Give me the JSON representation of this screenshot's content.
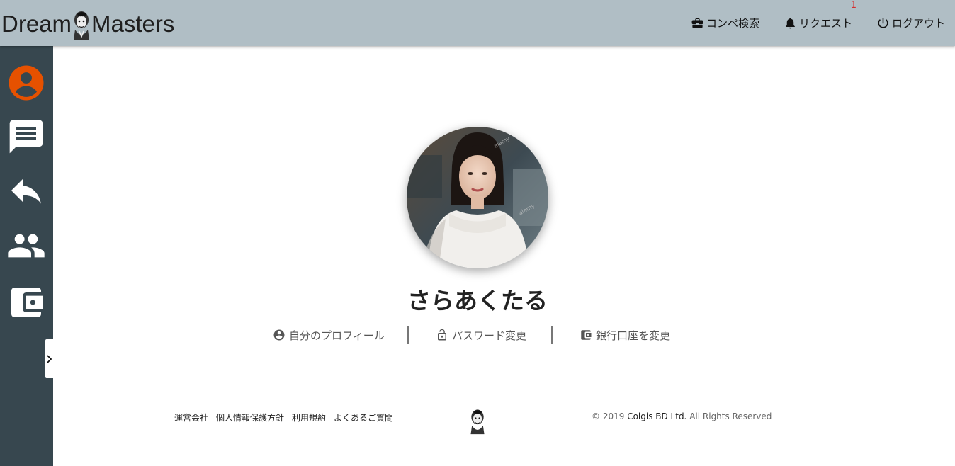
{
  "header": {
    "logo_left": "Dream",
    "logo_right": "Masters",
    "nav": {
      "search_label": "コンペ検索",
      "request_label": "リクエスト",
      "request_badge": "1",
      "logout_label": "ログアウト"
    }
  },
  "sidebar": {
    "items": [
      {
        "icon": "account-circle-icon",
        "active": true
      },
      {
        "icon": "message-icon",
        "active": false
      },
      {
        "icon": "reply-icon",
        "active": false
      },
      {
        "icon": "people-icon",
        "active": false
      },
      {
        "icon": "wallet-icon",
        "active": false
      }
    ],
    "active_color": "#e65100",
    "icon_color": "#ffffff"
  },
  "profile": {
    "name": "さらあくたる",
    "links": {
      "profile_label": "自分のプロフィール",
      "password_label": "パスワード変更",
      "bank_label": "銀行口座を変更"
    }
  },
  "footer": {
    "links": [
      "運営会社",
      "個人情報保護方針",
      "利用規約",
      "よくあるご質問"
    ],
    "copyright_prefix": "© 2019",
    "company": "Colgis BD Ltd.",
    "copyright_suffix": "All Rights Reserved"
  },
  "colors": {
    "header_bg": "#b0bec5",
    "sidebar_bg": "#37474f",
    "badge": "#d32f2f"
  }
}
